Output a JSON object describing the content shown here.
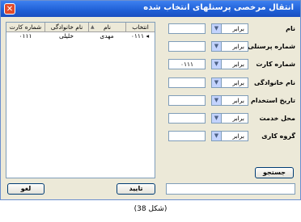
{
  "window": {
    "title": "انتقال مرخصی پرسنلهای انتخاب شده"
  },
  "grid": {
    "columns": [
      "انتخاب",
      "نام",
      "نام خانوادگی",
      "شماره کارت"
    ],
    "rows": [
      {
        "select": "۰۱۱۱",
        "name": "مهدی",
        "family": "خلیلی",
        "card": "۰۱۱۱"
      }
    ]
  },
  "filters": [
    {
      "label": "نام",
      "operator": "برابر",
      "value": ""
    },
    {
      "label": "شماره پرسنلی",
      "operator": "برابر",
      "value": ""
    },
    {
      "label": "شماره کارت",
      "operator": "برابر",
      "value": "۰۱۱۱"
    },
    {
      "label": "نام خانوادگی",
      "operator": "برابر",
      "value": ""
    },
    {
      "label": "تاریخ استخدام",
      "operator": "برابر",
      "value": ""
    },
    {
      "label": "محل خدمت",
      "operator": "برابر",
      "value": ""
    },
    {
      "label": "گروه کاری",
      "operator": "برابر",
      "value": ""
    }
  ],
  "buttons": {
    "search": "جستجو",
    "confirm": "تایید",
    "cancel": "لغو"
  },
  "status_field": "",
  "caption": "(شکل 38)"
}
